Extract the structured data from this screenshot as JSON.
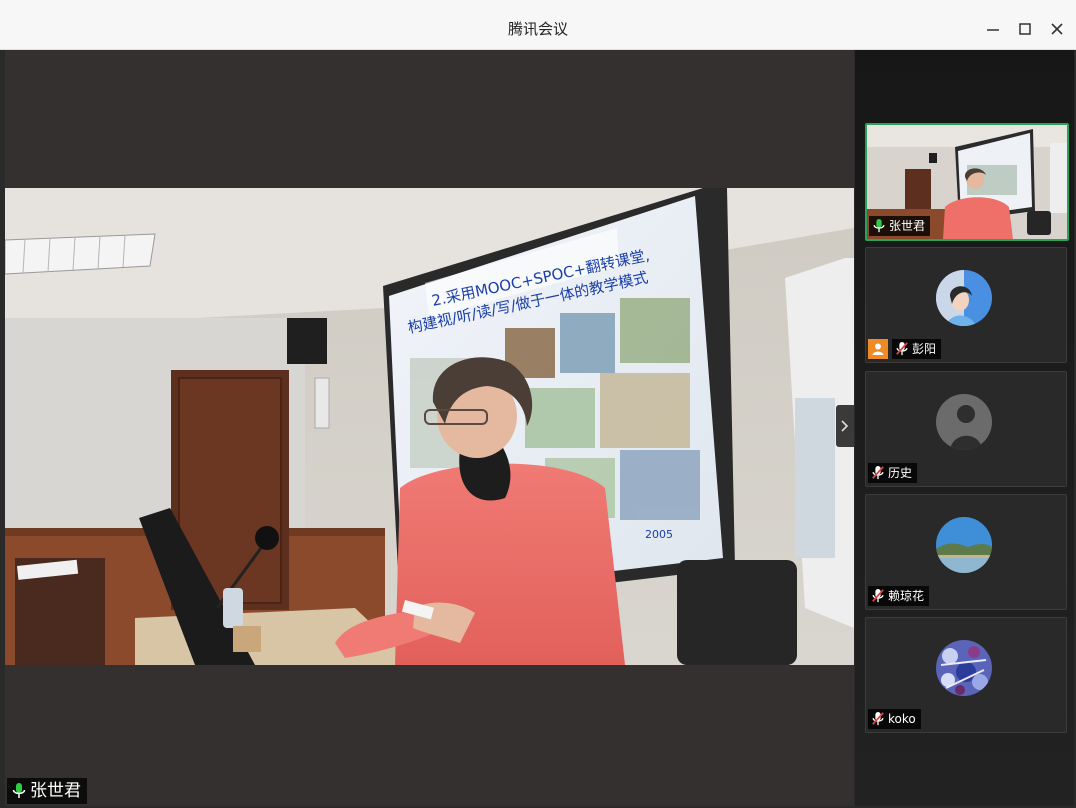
{
  "window": {
    "title": "腾讯会议"
  },
  "main_video": {
    "speaker_name": "张世君",
    "slide_title_line1": "2.采用MOOC+SPOC+翻转课堂,",
    "slide_title_line2": "构建视/听/读/写/做于一体的教学模式",
    "slide_footer": "2005"
  },
  "participants": [
    {
      "name": "张世君",
      "mic": "on",
      "active": true
    },
    {
      "name": "彭阳",
      "mic": "muted",
      "host": true
    },
    {
      "name": "历史",
      "mic": "muted"
    },
    {
      "name": "赖琼花",
      "mic": "muted"
    },
    {
      "name": "koko",
      "mic": "muted"
    }
  ],
  "colors": {
    "active_border": "#27a35a",
    "mic_on": "#2ecc40",
    "mic_muted": "#e04040",
    "host_badge": "#f08a24"
  }
}
